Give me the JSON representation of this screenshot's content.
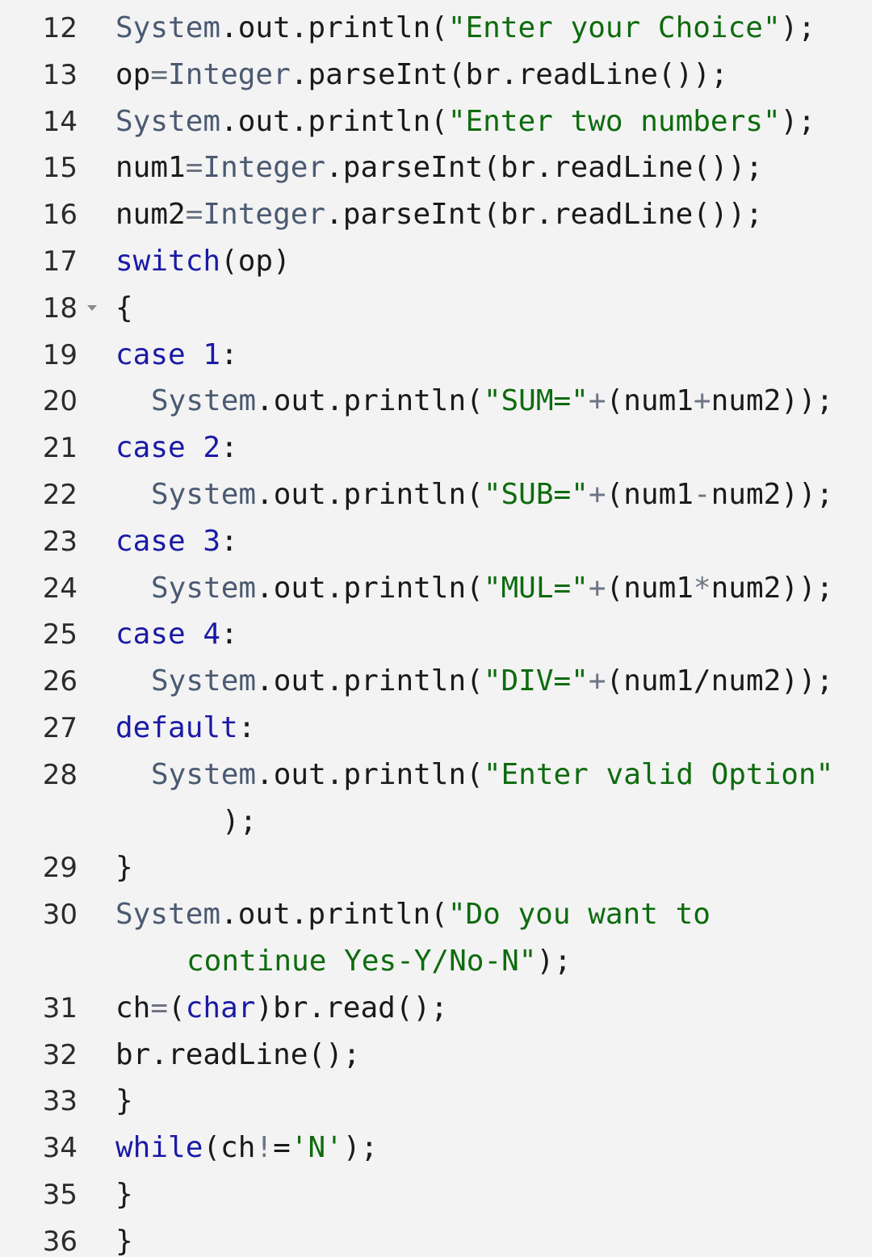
{
  "colors": {
    "background": "#f3f3f3",
    "keyword": "#1a1aa6",
    "type": "#4b5a72",
    "string": "#0e6b0e",
    "operator": "#6d7684",
    "plain": "#1a1a1a"
  },
  "editor": {
    "fold_marker_icon": "fold-triangle-down-icon",
    "lines": [
      {
        "num": "12",
        "indent": 0,
        "tokens": [
          [
            "type",
            "System"
          ],
          [
            "pl",
            ".out.println("
          ],
          [
            "str",
            "\"Enter your Choice\""
          ],
          [
            "pl",
            ");"
          ]
        ]
      },
      {
        "num": "13",
        "indent": 0,
        "tokens": [
          [
            "pl",
            "op"
          ],
          [
            "op",
            "="
          ],
          [
            "type",
            "Integer"
          ],
          [
            "pl",
            ".parseInt(br.readLine());"
          ]
        ]
      },
      {
        "num": "14",
        "indent": 0,
        "tokens": [
          [
            "type",
            "System"
          ],
          [
            "pl",
            ".out.println("
          ],
          [
            "str",
            "\"Enter two numbers\""
          ],
          [
            "pl",
            ");"
          ]
        ]
      },
      {
        "num": "15",
        "indent": 0,
        "tokens": [
          [
            "pl",
            "num1"
          ],
          [
            "op",
            "="
          ],
          [
            "type",
            "Integer"
          ],
          [
            "pl",
            ".parseInt(br.readLine());"
          ]
        ]
      },
      {
        "num": "16",
        "indent": 0,
        "tokens": [
          [
            "pl",
            "num2"
          ],
          [
            "op",
            "="
          ],
          [
            "type",
            "Integer"
          ],
          [
            "pl",
            ".parseInt(br.readLine());"
          ]
        ]
      },
      {
        "num": "17",
        "indent": 0,
        "tokens": [
          [
            "kw",
            "switch"
          ],
          [
            "pl",
            "(op)"
          ]
        ]
      },
      {
        "num": "18",
        "indent": 0,
        "fold": true,
        "tokens": [
          [
            "pl",
            "{"
          ]
        ]
      },
      {
        "num": "19",
        "indent": 0,
        "tokens": [
          [
            "kw",
            "case"
          ],
          [
            "pl",
            " "
          ],
          [
            "num",
            "1"
          ],
          [
            "pl",
            ":"
          ]
        ]
      },
      {
        "num": "20",
        "indent": 1,
        "tokens": [
          [
            "type",
            "System"
          ],
          [
            "pl",
            ".out.println("
          ],
          [
            "str",
            "\"SUM=\""
          ],
          [
            "op",
            "+"
          ],
          [
            "pl",
            "(num1"
          ],
          [
            "op",
            "+"
          ],
          [
            "pl",
            "num2));"
          ]
        ]
      },
      {
        "num": "21",
        "indent": 0,
        "tokens": [
          [
            "kw",
            "case"
          ],
          [
            "pl",
            " "
          ],
          [
            "num",
            "2"
          ],
          [
            "pl",
            ":"
          ]
        ]
      },
      {
        "num": "22",
        "indent": 1,
        "tokens": [
          [
            "type",
            "System"
          ],
          [
            "pl",
            ".out.println("
          ],
          [
            "str",
            "\"SUB=\""
          ],
          [
            "op",
            "+"
          ],
          [
            "pl",
            "(num1"
          ],
          [
            "op",
            "-"
          ],
          [
            "pl",
            "num2));"
          ]
        ]
      },
      {
        "num": "23",
        "indent": 0,
        "tokens": [
          [
            "kw",
            "case"
          ],
          [
            "pl",
            " "
          ],
          [
            "num",
            "3"
          ],
          [
            "pl",
            ":"
          ]
        ]
      },
      {
        "num": "24",
        "indent": 1,
        "tokens": [
          [
            "type",
            "System"
          ],
          [
            "pl",
            ".out.println("
          ],
          [
            "str",
            "\"MUL=\""
          ],
          [
            "op",
            "+"
          ],
          [
            "pl",
            "(num1"
          ],
          [
            "op",
            "*"
          ],
          [
            "pl",
            "num2));"
          ]
        ]
      },
      {
        "num": "25",
        "indent": 0,
        "tokens": [
          [
            "kw",
            "case"
          ],
          [
            "pl",
            " "
          ],
          [
            "num",
            "4"
          ],
          [
            "pl",
            ":"
          ]
        ]
      },
      {
        "num": "26",
        "indent": 1,
        "tokens": [
          [
            "type",
            "System"
          ],
          [
            "pl",
            ".out.println("
          ],
          [
            "str",
            "\"DIV=\""
          ],
          [
            "op",
            "+"
          ],
          [
            "pl",
            "(num1/num2));"
          ]
        ]
      },
      {
        "num": "27",
        "indent": 0,
        "tokens": [
          [
            "kw",
            "default"
          ],
          [
            "pl",
            ":"
          ]
        ]
      },
      {
        "num": "28",
        "indent": 1,
        "tokens": [
          [
            "type",
            "System"
          ],
          [
            "pl",
            ".out.println("
          ],
          [
            "str",
            "\"Enter valid Option\""
          ]
        ]
      },
      {
        "num": "",
        "indent": 3,
        "tokens": [
          [
            "pl",
            ");"
          ]
        ]
      },
      {
        "num": "29",
        "indent": 0,
        "tokens": [
          [
            "pl",
            "}"
          ]
        ]
      },
      {
        "num": "30",
        "indent": 0,
        "tokens": [
          [
            "type",
            "System"
          ],
          [
            "pl",
            ".out.println("
          ],
          [
            "str",
            "\"Do you want to"
          ]
        ]
      },
      {
        "num": "",
        "indent": 2,
        "tokens": [
          [
            "str",
            "continue Yes-Y/No-N\""
          ],
          [
            "pl",
            ");"
          ]
        ]
      },
      {
        "num": "31",
        "indent": 0,
        "tokens": [
          [
            "pl",
            "ch"
          ],
          [
            "op",
            "="
          ],
          [
            "pl",
            "("
          ],
          [
            "kw",
            "char"
          ],
          [
            "pl",
            ")br.read();"
          ]
        ]
      },
      {
        "num": "32",
        "indent": 0,
        "tokens": [
          [
            "pl",
            "br.readLine();"
          ]
        ]
      },
      {
        "num": "33",
        "indent": 0,
        "tokens": [
          [
            "pl",
            "}"
          ]
        ]
      },
      {
        "num": "34",
        "indent": 0,
        "tokens": [
          [
            "kw",
            "while"
          ],
          [
            "pl",
            "(ch"
          ],
          [
            "op",
            "!"
          ],
          [
            "pl",
            "="
          ],
          [
            "str",
            "'N'"
          ],
          [
            "pl",
            ");"
          ]
        ]
      },
      {
        "num": "35",
        "indent": 0,
        "tokens": [
          [
            "pl",
            "}"
          ]
        ]
      },
      {
        "num": "36",
        "indent": 0,
        "tokens": [
          [
            "pl",
            "}"
          ]
        ]
      }
    ]
  }
}
